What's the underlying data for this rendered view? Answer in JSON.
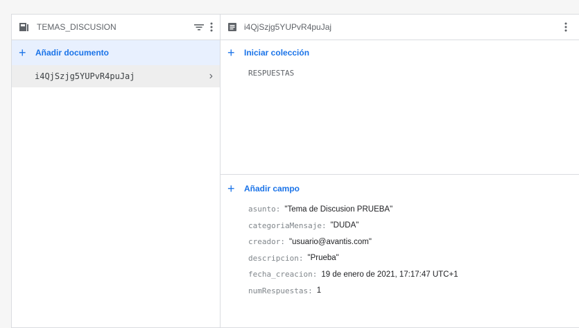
{
  "left_panel": {
    "title": "TEMAS_DISCUSION",
    "add_label": "Añadir documento",
    "documents": [
      {
        "id": "i4QjSzjg5YUPvR4puJaj"
      }
    ]
  },
  "right_panel": {
    "title": "i4QjSzjg5YUPvR4puJaj",
    "add_collection_label": "Iniciar colección",
    "collections": [
      "RESPUESTAS"
    ],
    "add_field_label": "Añadir campo",
    "fields": [
      {
        "key": "asunto:",
        "value": "\"Tema de Discusion PRUEBA\""
      },
      {
        "key": "categoriaMensaje:",
        "value": "\"DUDA\""
      },
      {
        "key": "creador:",
        "value": "\"usuario@avantis.com\""
      },
      {
        "key": "descripcion:",
        "value": "\"Prueba\""
      },
      {
        "key": "fecha_creacion:",
        "value": "19 de enero de 2021, 17:17:47 UTC+1"
      },
      {
        "key": "numRespuestas:",
        "value": "1"
      }
    ]
  },
  "colors": {
    "accent": "#1a73e8",
    "selected_bg": "#e8f0fe",
    "item_bg": "#eeeeee"
  }
}
